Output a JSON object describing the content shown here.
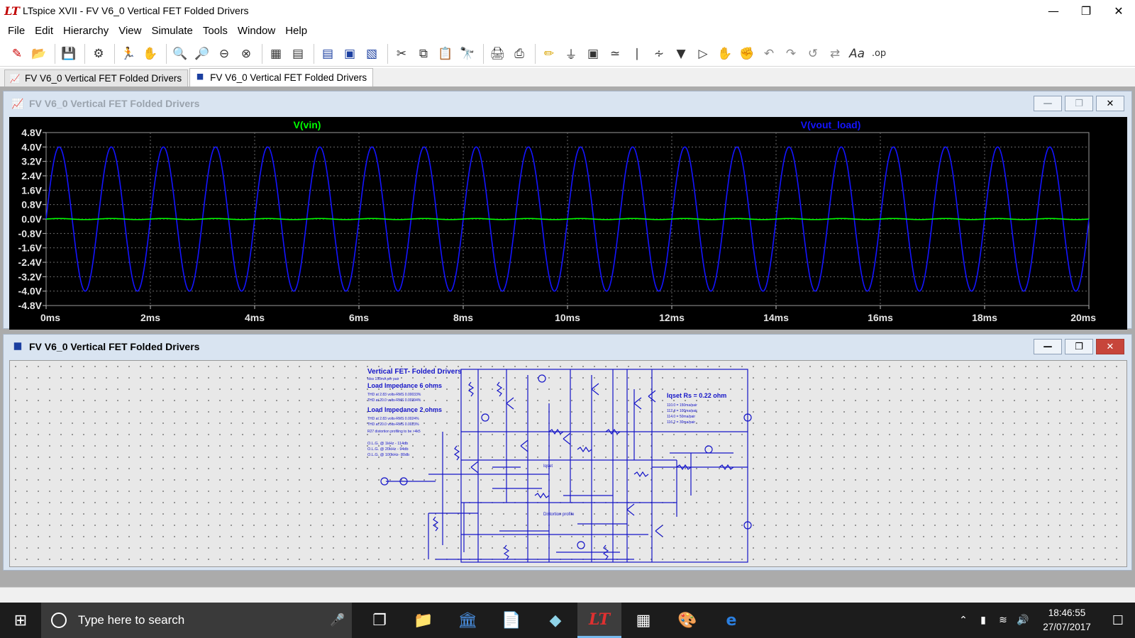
{
  "window": {
    "title": "LTspice XVII - FV V6_0 Vertical FET Folded Drivers",
    "logo": "LT"
  },
  "menu": [
    "File",
    "Edit",
    "Hierarchy",
    "View",
    "Simulate",
    "Tools",
    "Window",
    "Help"
  ],
  "tabs": [
    {
      "label": "FV V6_0 Vertical FET Folded Drivers",
      "icon": "waveform-icon"
    },
    {
      "label": "FV V6_0 Vertical FET Folded Drivers",
      "icon": "schematic-icon",
      "active": true
    }
  ],
  "waveform_window": {
    "title": "FV V6_0 Vertical FET Folded Drivers"
  },
  "schematic_window": {
    "title": "FV V6_0 Vertical FET Folded Drivers"
  },
  "schematic_text": {
    "title": "Vertical FET- Folded Drivers",
    "bias": "Idss 150mA per pair",
    "load6": "Load Impedance 6 ohms",
    "thd6a": "THD at 2.83 volts-RMS 0.00033%",
    "thd6b": "THD at 20.0 volts-RMS 0.00394%",
    "load2": "Load Impedance 2 ohms",
    "thd2a": "THD at 2.83 volts-RMS 0.0024%",
    "thd2b": "THD at 20.0 volts-RMS 0.0023%",
    "profiling": "R27 distortion profiling to be >4k5",
    "olg1": "O.L.G. @     1kHz  - 114db",
    "olg2": "O.L.G. @   20kHz -  94db",
    "olg3": "O.L.G. @ 100kHz-   80db",
    "iqset": "Iqset Rs = 0.22 ohm",
    "iq1": "110.0 = 150ma/pair",
    "iq2": "112.4 = 100ma/pair",
    "iq3": "114.0 =  50ma/pair",
    "iq4": "116.2 =  30ma/pair",
    "iqset_label": "Iqset",
    "dist_profile": "Distortion profile"
  },
  "chart_data": {
    "type": "line",
    "title": "",
    "xlabel": "",
    "ylabel": "",
    "x_ticks": [
      "0ms",
      "2ms",
      "4ms",
      "6ms",
      "8ms",
      "10ms",
      "12ms",
      "14ms",
      "16ms",
      "18ms",
      "20ms"
    ],
    "y_ticks": [
      "4.8V",
      "4.0V",
      "3.2V",
      "2.4V",
      "1.6V",
      "0.8V",
      "0.0V",
      "-0.8V",
      "-1.6V",
      "-2.4V",
      "-3.2V",
      "-4.0V",
      "-4.8V"
    ],
    "xlim": [
      0,
      20
    ],
    "ylim": [
      -4.8,
      4.8
    ],
    "grid": true,
    "background": "#000000",
    "series": [
      {
        "name": "V(vin)",
        "color": "#00ff00",
        "frequency_khz": 1,
        "amplitude_v": 0.03,
        "phase": "sine"
      },
      {
        "name": "V(vout_load)",
        "color": "#1414ff",
        "frequency_khz": 1,
        "amplitude_v": 4.0,
        "phase": "sine"
      }
    ]
  },
  "taskbar": {
    "search_placeholder": "Type here to search",
    "time": "18:46:55",
    "date": "27/07/2017"
  }
}
